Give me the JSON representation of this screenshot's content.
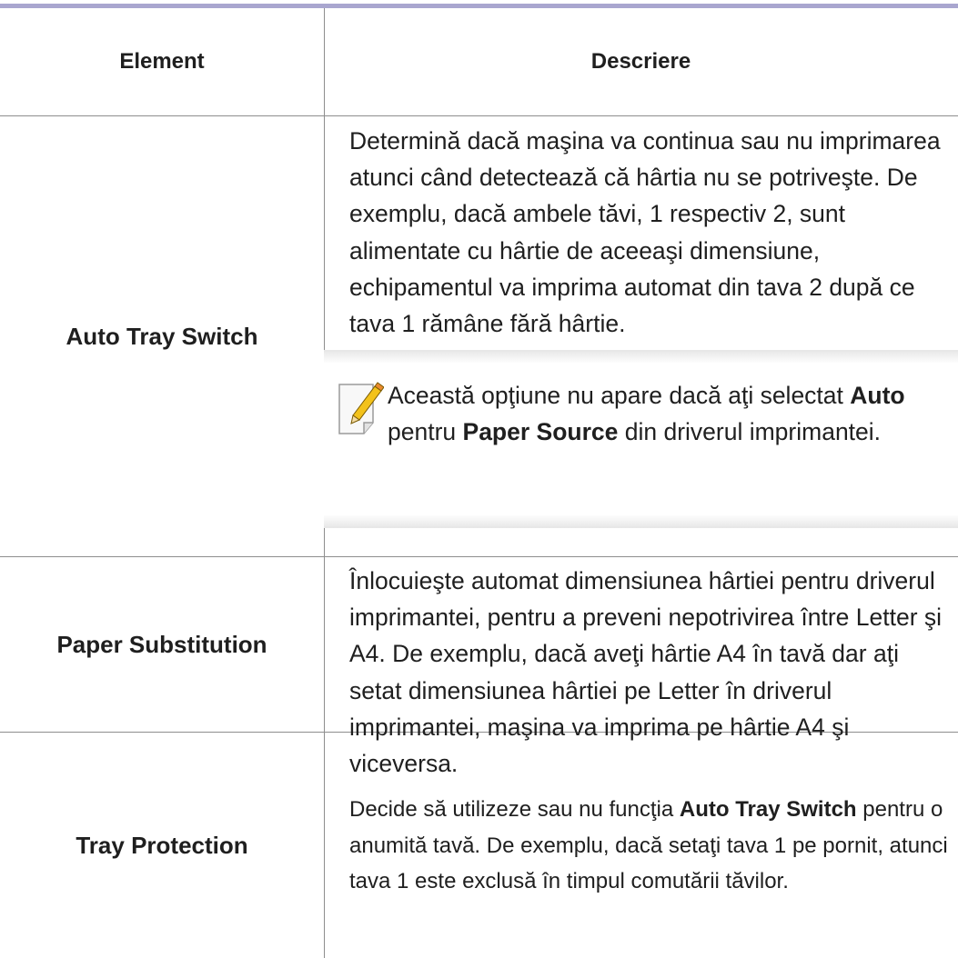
{
  "table": {
    "headers": {
      "element": "Element",
      "description": "Descriere"
    },
    "rows": [
      {
        "element": "Auto Tray Switch",
        "description": "Determină dacă maşina va continua sau nu imprimarea atunci când detectează că hârtia nu se potriveşte. De exemplu, dacă ambele tăvi, 1 respectiv 2, sunt alimentate cu hârtie de aceeaşi dimensiune, echipamentul va imprima automat din tava 2 după ce tava 1 rămâne fără hârtie.",
        "note": {
          "text_1": "Această opţiune nu apare dacă aţi selectat ",
          "bold_1": "Auto",
          "text_2": " pentru ",
          "bold_2": "Paper Source",
          "text_3": " din driverul imprimantei.",
          "icon": "note-pencil-icon"
        }
      },
      {
        "element": "Paper Substitution",
        "description": "Înlocuieşte automat dimensiunea hârtiei pentru driverul imprimantei, pentru a preveni nepotrivirea între Letter şi A4. De exemplu, dacă aveţi hârtie A4 în tavă dar aţi setat dimensiunea hârtiei pe Letter în driverul imprimantei, maşina va imprima pe hârtie A4 şi viceversa."
      },
      {
        "element": "Tray Protection",
        "description_1": "Decide să utilizeze sau nu funcţia ",
        "description_bold": "Auto Tray Switch",
        "description_2": " pentru o anumită tavă. De exemplu, dacă setaţi tava 1 pe pornit, atunci tava 1 este exclusă în timpul comutării tăvilor."
      }
    ]
  },
  "colors": {
    "rule": "#a9a6cf",
    "grid": "#8e8e8e",
    "note_shade": "#e6e6e6"
  }
}
